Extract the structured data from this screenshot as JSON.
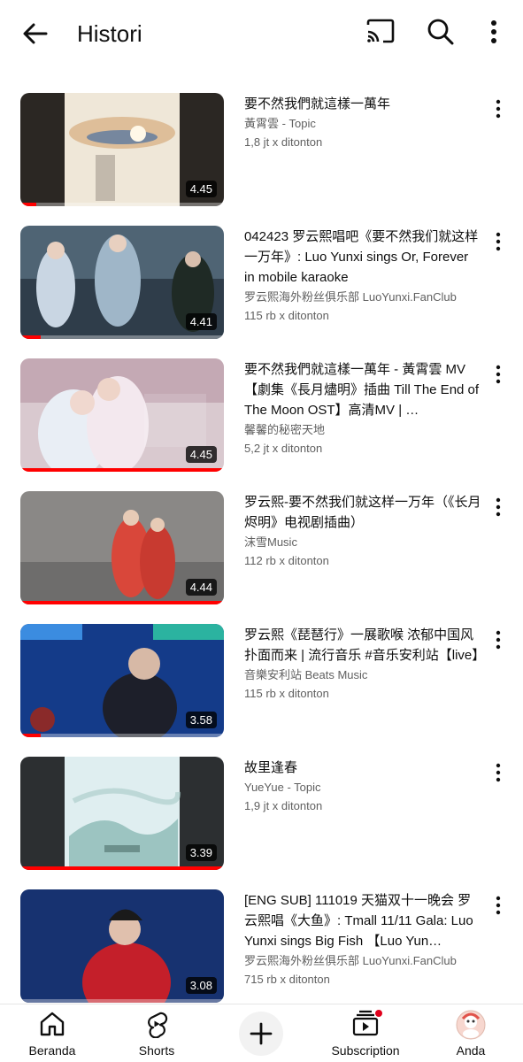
{
  "header": {
    "title": "Histori"
  },
  "videos": [
    {
      "title": "要不然我們就這樣一萬年",
      "channel": "黃霄雲 - Topic",
      "views": "1,8 jt x ditonton",
      "duration": "4.45",
      "progress": 0.08
    },
    {
      "title": "042423 罗云熙唱吧《要不然我们就这样一万年》: Luo Yunxi sings Or, Forever in mobile karaoke",
      "channel": "罗云熙海外粉丝俱乐部 LuoYunxi.FanClub",
      "views": "115 rb x ditonton",
      "duration": "4.41",
      "progress": 0.1
    },
    {
      "title": "要不然我們就這樣一萬年 - 黃霄雲 MV 【劇集《長月燼明》插曲 Till The End of The Moon OST】高清MV | …",
      "channel": "馨馨的秘密天地",
      "views": "5,2 jt x ditonton",
      "duration": "4.45",
      "progress": 1.0
    },
    {
      "title": "罗云熙-要不然我们就这样一万年（《长月烬明》电视剧插曲）",
      "channel": "沫雪Music",
      "views": "112 rb x ditonton",
      "duration": "4.44",
      "progress": 1.0
    },
    {
      "title": "罗云熙《琵琶行》一展歌喉 浓郁中国风扑面而来 | 流行音乐 #音乐安利站【live】",
      "channel": "音樂安利站 Beats Music",
      "views": "115 rb x ditonton",
      "duration": "3.58",
      "progress": 0.1
    },
    {
      "title": "故里逢春",
      "channel": "YueYue - Topic",
      "views": "1,9 jt x ditonton",
      "duration": "3.39",
      "progress": 1.0
    },
    {
      "title": "[ENG SUB] 111019 天猫双十一晚会 罗云熙唱《大鱼》: Tmall 11/11 Gala: Luo Yunxi sings Big Fish 【Luo Yun…",
      "channel": "罗云熙海外粉丝俱乐部 LuoYunxi.FanClub",
      "views": "715 rb x ditonton",
      "duration": "3.08",
      "progress": 0.0
    }
  ],
  "nav": {
    "home": "Beranda",
    "shorts": "Shorts",
    "subscriptions": "Subscription",
    "you": "Anda"
  },
  "icons": {
    "back": "arrow-left-icon",
    "cast": "cast-icon",
    "search": "search-icon",
    "more": "more-vert-icon"
  },
  "colors": {
    "accent": "#ff0000",
    "text": "#0f0f0f",
    "secondary": "#606060"
  }
}
